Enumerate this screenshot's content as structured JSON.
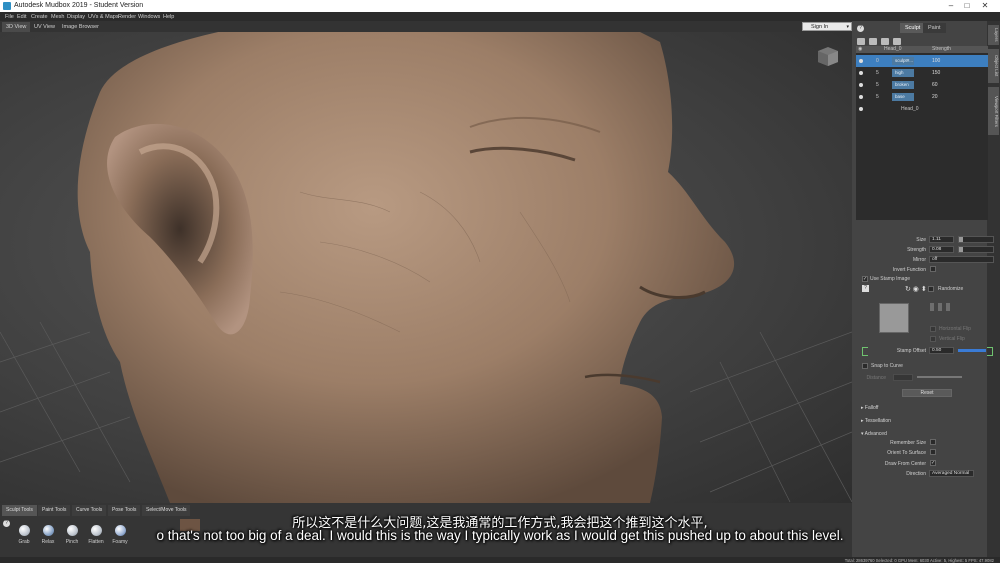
{
  "window": {
    "title": "Autodesk Mudbox 2019 - Student Version",
    "controls": [
      "–",
      "□",
      "✕"
    ]
  },
  "menu": [
    "File",
    "Edit",
    "Create",
    "Mesh",
    "Display",
    "UVs & Maps",
    "Render",
    "Windows",
    "Help"
  ],
  "view_tabs": [
    "3D View",
    "UV View",
    "Image Browser"
  ],
  "sign_in": "Sign In",
  "panel_tabs": [
    "Sculpt",
    "Paint"
  ],
  "side_tabs": [
    "Layers",
    "Object List",
    "Viewport Filters"
  ],
  "layers": {
    "header": {
      "name": "Head_0",
      "value": "Strength"
    },
    "rows": [
      {
        "name": "sculpt#...",
        "value": "100",
        "num": "0"
      },
      {
        "name": "high",
        "value": "150",
        "num": "5"
      },
      {
        "name": "broken",
        "value": "60",
        "num": "5"
      },
      {
        "name": "base",
        "value": "20",
        "num": "5"
      }
    ],
    "base_layer": "Head_0"
  },
  "props": {
    "size_label": "Size",
    "size_value": "1.11",
    "strength_label": "Strength",
    "strength_value": "0.08",
    "mirror_label": "Mirror",
    "mirror_value": "off",
    "invert_label": "Invert Function",
    "use_stamp_label": "Use Stamp Image",
    "randomize_label": "Randomize",
    "horizontal_flip": "Horizontal Flip",
    "vertical_flip": "Vertical Flip",
    "stamp_offset_label": "Stamp Offset",
    "stamp_offset_value": "0.50",
    "snap_label": "Snap to Curve",
    "distance_label": "Distance",
    "reset_label": "Reset",
    "falloff": "Falloff",
    "tessellation": "Tessellation",
    "advanced": "Advanced",
    "remember_size": "Remember Size",
    "orient_surface": "Orient To Surface",
    "draw_center": "Draw From Center",
    "direction_label": "Direction",
    "direction_value": "Averaged Normal"
  },
  "tool_tabs": [
    "Sculpt Tools",
    "Paint Tools",
    "Curve Tools",
    "Pose Tools",
    "Select/Move Tools"
  ],
  "tools": [
    "Grab",
    "Relax",
    "Pinch",
    "Flatten",
    "Foamy"
  ],
  "status": "Total: 28639760  Selected: 0 GPU Mem: 6030  Active: 5, Highest: 5 FPS: 47.9082",
  "subtitles": {
    "cn": "所以这不是什么大问题,这是我通常的工作方式,我会把这个推到这个水平,",
    "en": "o that's not too big of a deal. I would this is the way I typically work as I would get this pushed up to about this level."
  }
}
